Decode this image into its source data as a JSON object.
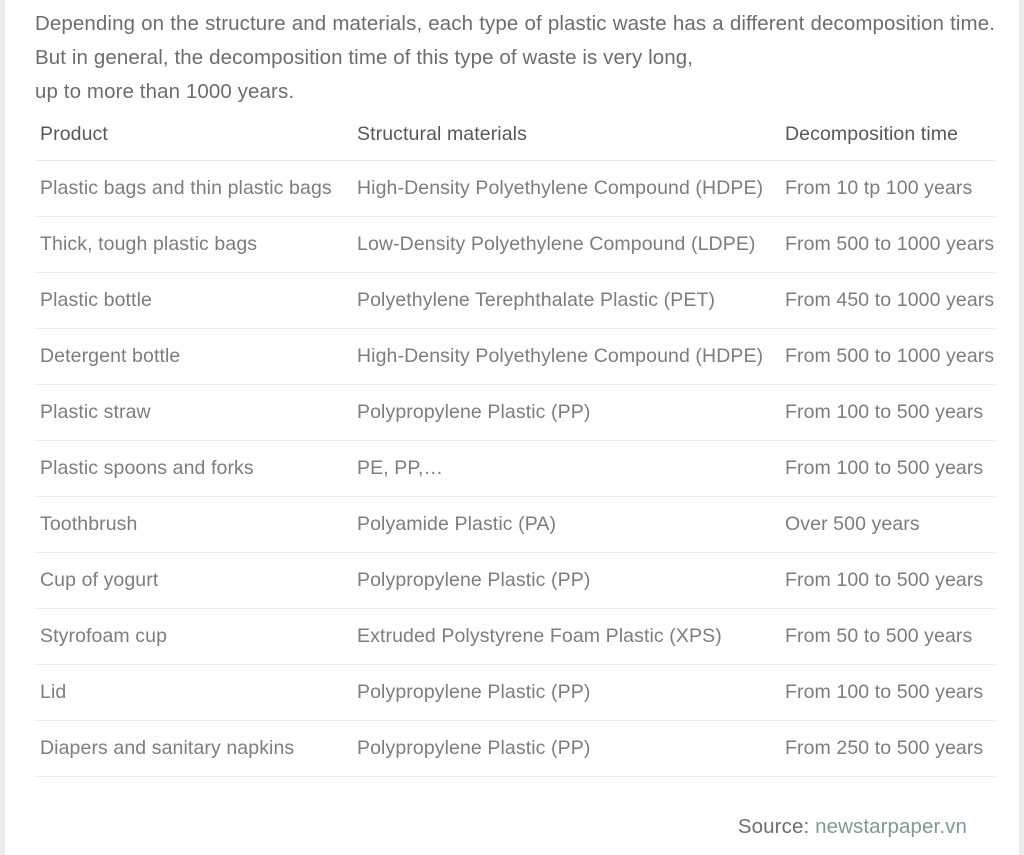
{
  "intro": {
    "text": "Depending on the structure and materials, each type of plastic waste has a different decomposition time. But in general, the decomposition time of this type of waste is very long,",
    "last_line": "up to more than 1000 years."
  },
  "table": {
    "headers": {
      "product": "Product",
      "materials": "Structural materials",
      "time": "Decomposition time"
    },
    "rows": [
      {
        "product": "Plastic bags and thin plastic bags",
        "materials": "High-Density Polyethylene Compound (HDPE)",
        "time": "From 10 tp 100 years"
      },
      {
        "product": "Thick, tough plastic bags",
        "materials": "Low-Density Polyethylene Compound (LDPE)",
        "time": "From 500 to 1000 years"
      },
      {
        "product": "Plastic bottle",
        "materials": "Polyethylene Terephthalate Plastic (PET)",
        "time": "From 450 to 1000 years"
      },
      {
        "product": "Detergent bottle",
        "materials": "High-Density Polyethylene Compound (HDPE)",
        "time": "From 500 to 1000 years"
      },
      {
        "product": "Plastic straw",
        "materials": "Polypropylene Plastic (PP)",
        "time": "From 100 to 500 years"
      },
      {
        "product": "Plastic spoons and forks",
        "materials": "PE, PP,…",
        "time": "From 100 to 500 years"
      },
      {
        "product": "Toothbrush",
        "materials": "Polyamide Plastic (PA)",
        "time": "Over 500 years"
      },
      {
        "product": "Cup of yogurt",
        "materials": "Polypropylene Plastic (PP)",
        "time": "From 100 to 500 years"
      },
      {
        "product": "Styrofoam cup",
        "materials": "Extruded Polystyrene Foam Plastic (XPS)",
        "time": "From 50 to 500 years"
      },
      {
        "product": "Lid",
        "materials": "Polypropylene Plastic (PP)",
        "time": "From 100 to 500 years"
      },
      {
        "product": "Diapers and sanitary napkins",
        "materials": "Polypropylene Plastic (PP)",
        "time": "From 250 to 500 years"
      }
    ]
  },
  "source": {
    "label": "Source:",
    "link_text": "newstarpaper.vn",
    "link_color": "#7e9c8c"
  },
  "colors": {
    "page_background": "#ececec",
    "card_background": "#ffffff",
    "intro_text": "#6d6d6d",
    "header_text": "#585858",
    "body_text": "#7d7d7d",
    "divider": "#ededed"
  }
}
